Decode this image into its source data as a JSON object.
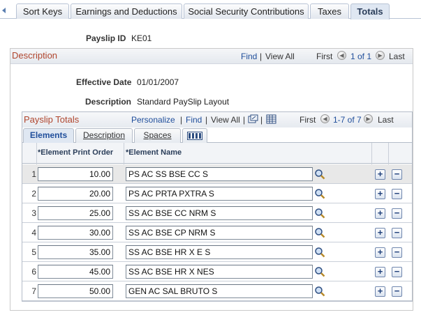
{
  "page_tabs": [
    {
      "label": "Sort Keys"
    },
    {
      "label": "Earnings and Deductions"
    },
    {
      "label": "Social Security Contributions"
    },
    {
      "label": "Taxes"
    },
    {
      "label": "Totals"
    }
  ],
  "payslip": {
    "id_label": "Payslip ID",
    "id_value": "KE01"
  },
  "description_area": {
    "title": "Description",
    "find": "Find",
    "view_all": "View All",
    "first": "First",
    "range": "1 of 1",
    "last": "Last",
    "effective_date_label": "Effective Date",
    "effective_date": "01/01/2007",
    "description_label": "Description",
    "description": "Standard PaySlip Layout"
  },
  "grid": {
    "title": "Payslip Totals",
    "personalize": "Personalize",
    "find": "Find",
    "view_all": "View All",
    "first": "First",
    "range": "1-7 of 7",
    "last": "Last",
    "tabs": [
      {
        "label": "Elements"
      },
      {
        "label": "Description"
      },
      {
        "label": "Spaces"
      }
    ],
    "columns": {
      "order": "*Element Print Order",
      "name": "*Element Name"
    },
    "rows": [
      {
        "num": "1",
        "order": "10.00",
        "name": "PS AC SS BSE CC S"
      },
      {
        "num": "2",
        "order": "20.00",
        "name": "PS AC PRTA PXTRA S"
      },
      {
        "num": "3",
        "order": "25.00",
        "name": "SS AC BSE CC NRM S"
      },
      {
        "num": "4",
        "order": "30.00",
        "name": "SS AC BSE CP NRM S"
      },
      {
        "num": "5",
        "order": "35.00",
        "name": "SS AC BSE HR X E S"
      },
      {
        "num": "6",
        "order": "45.00",
        "name": "SS AC BSE HR X NES"
      },
      {
        "num": "7",
        "order": "50.00",
        "name": "GEN AC SAL BRUTO S"
      }
    ],
    "add_symbol": "+",
    "remove_symbol": "−"
  },
  "icons": {
    "lookup": "magnifier-icon",
    "add": "add-row-icon",
    "remove": "delete-row-icon",
    "zoom": "new-window-icon",
    "download": "download-grid-icon",
    "show_all_columns": "show-all-columns-icon"
  },
  "colors": {
    "accent_title": "#b0462e",
    "link": "#1f4e9b"
  }
}
